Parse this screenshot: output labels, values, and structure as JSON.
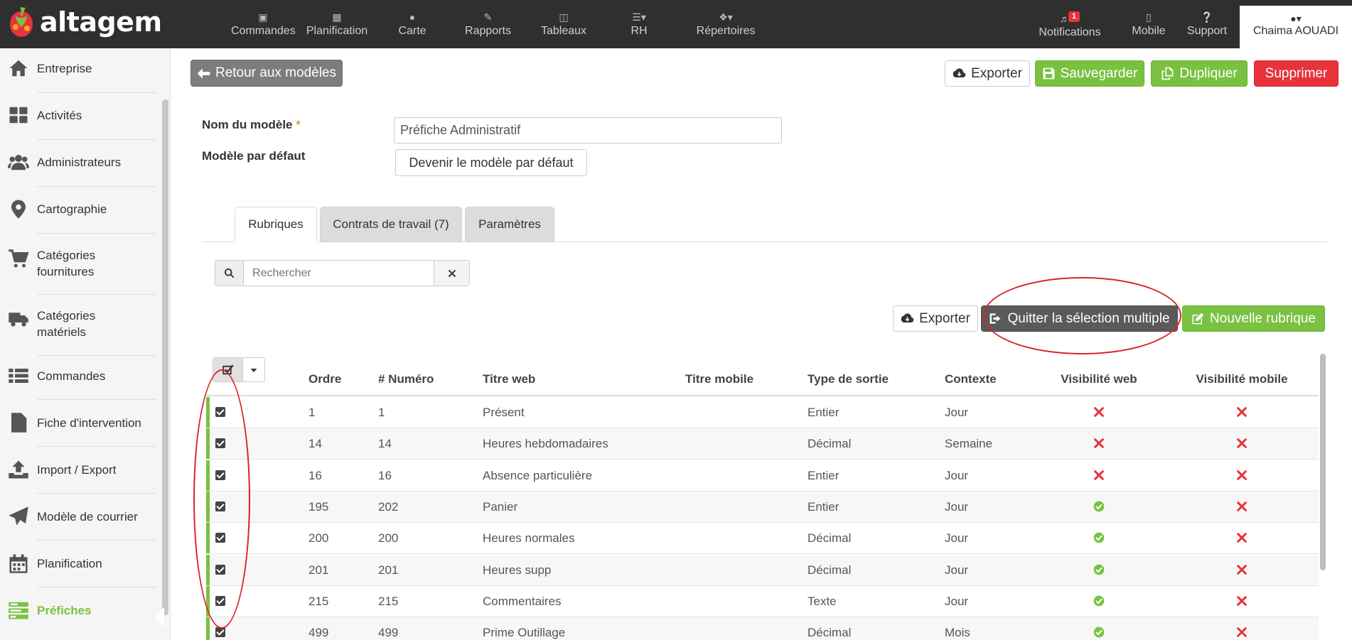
{
  "app": {
    "brand": "altagem"
  },
  "topnav": {
    "items": [
      {
        "label": "Commandes",
        "icon": "inbox-icon"
      },
      {
        "label": "Planification",
        "icon": "calendar-icon"
      },
      {
        "label": "Carte",
        "icon": "map-marker-icon"
      },
      {
        "label": "Rapports",
        "icon": "edit-icon"
      },
      {
        "label": "Tableaux",
        "icon": "columns-icon"
      },
      {
        "label": "RH",
        "icon": "list-icon"
      },
      {
        "label": "Répertoires",
        "icon": "cubes-icon"
      }
    ],
    "notifications": {
      "label": "Notifications",
      "count": "1"
    },
    "mobile": {
      "label": "Mobile"
    },
    "support": {
      "label": "Support"
    },
    "user": {
      "name": "Chaima AOUADI"
    }
  },
  "sidebar": {
    "items": [
      {
        "label": "Entreprise"
      },
      {
        "label": "Activités"
      },
      {
        "label": "Administrateurs"
      },
      {
        "label": "Cartographie"
      },
      {
        "label": "Catégories fournitures"
      },
      {
        "label": "Catégories matériels"
      },
      {
        "label": "Commandes"
      },
      {
        "label": "Fiche d'intervention"
      },
      {
        "label": "Import / Export"
      },
      {
        "label": "Modèle de courrier"
      },
      {
        "label": "Planification"
      },
      {
        "label": "Préfiches"
      }
    ],
    "active_index": 11
  },
  "toolbar": {
    "back_label": "Retour aux modèles",
    "export_label": "Exporter",
    "save_label": "Sauvegarder",
    "duplicate_label": "Dupliquer",
    "delete_label": "Supprimer"
  },
  "form": {
    "name_label": "Nom du modèle",
    "name_required": "*",
    "name_value": "Préfiche Administratif",
    "default_label": "Modèle par défaut",
    "default_button": "Devenir le modèle par défaut"
  },
  "tabs": [
    {
      "label": "Rubriques",
      "active": true
    },
    {
      "label": "Contrats de travail (7)",
      "active": false
    },
    {
      "label": "Paramètres",
      "active": false
    }
  ],
  "search": {
    "placeholder": "Rechercher"
  },
  "list_toolbar": {
    "export_label": "Exporter",
    "quit_multi_label": "Quitter la sélection multiple",
    "new_label": "Nouvelle rubrique"
  },
  "table": {
    "headers": {
      "ordre": "Ordre",
      "numero": "# Numéro",
      "titre_web": "Titre web",
      "titre_mobile": "Titre mobile",
      "type_sortie": "Type de sortie",
      "contexte": "Contexte",
      "vis_web": "Visibilité web",
      "vis_mobile": "Visibilité mobile"
    },
    "rows": [
      {
        "ordre": "1",
        "numero": "1",
        "titre_web": "Présent",
        "titre_mobile": "",
        "type": "Entier",
        "contexte": "Jour",
        "vis_web": false,
        "vis_mobile": false,
        "checked": true
      },
      {
        "ordre": "14",
        "numero": "14",
        "titre_web": "Heures hebdomadaires",
        "titre_mobile": "",
        "type": "Décimal",
        "contexte": "Semaine",
        "vis_web": false,
        "vis_mobile": false,
        "checked": true
      },
      {
        "ordre": "16",
        "numero": "16",
        "titre_web": "Absence particulière",
        "titre_mobile": "",
        "type": "Entier",
        "contexte": "Jour",
        "vis_web": false,
        "vis_mobile": false,
        "checked": true
      },
      {
        "ordre": "195",
        "numero": "202",
        "titre_web": "Panier",
        "titre_mobile": "",
        "type": "Entier",
        "contexte": "Jour",
        "vis_web": true,
        "vis_mobile": false,
        "checked": true
      },
      {
        "ordre": "200",
        "numero": "200",
        "titre_web": "Heures normales",
        "titre_mobile": "",
        "type": "Décimal",
        "contexte": "Jour",
        "vis_web": true,
        "vis_mobile": false,
        "checked": true
      },
      {
        "ordre": "201",
        "numero": "201",
        "titre_web": "Heures supp",
        "titre_mobile": "",
        "type": "Décimal",
        "contexte": "Jour",
        "vis_web": true,
        "vis_mobile": false,
        "checked": true
      },
      {
        "ordre": "215",
        "numero": "215",
        "titre_web": "Commentaires",
        "titre_mobile": "",
        "type": "Texte",
        "contexte": "Jour",
        "vis_web": true,
        "vis_mobile": false,
        "checked": true
      },
      {
        "ordre": "499",
        "numero": "499",
        "titre_web": "Prime Outillage",
        "titre_mobile": "",
        "type": "Décimal",
        "contexte": "Mois",
        "vis_web": true,
        "vis_mobile": false,
        "checked": true
      }
    ]
  },
  "colors": {
    "topbar": "#2f2f2f",
    "accent_green": "#7ac142",
    "danger_red": "#e8323c",
    "annotation_red": "#d8232a"
  }
}
